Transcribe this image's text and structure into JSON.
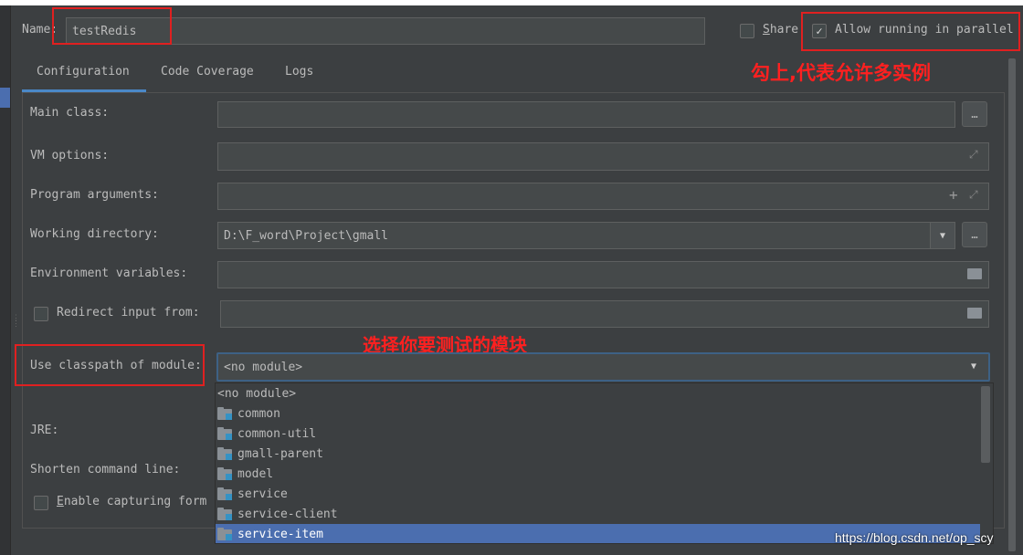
{
  "header": {
    "name_label": "Name:",
    "name_value": "testRedis",
    "share_label": "Share",
    "share_checked": false,
    "allow_parallel_label": "Allow running in parallel",
    "allow_parallel_checked": true
  },
  "annotations": {
    "parallel_note": "勾上,代表允许多实例",
    "module_note": "选择你要测试的模块"
  },
  "tabs": [
    {
      "label": "Configuration",
      "active": true
    },
    {
      "label": "Code Coverage",
      "active": false
    },
    {
      "label": "Logs",
      "active": false
    }
  ],
  "form": {
    "main_class_label": "Main class:",
    "main_class_value": "",
    "vm_options_label": "VM options:",
    "vm_options_value": "",
    "program_args_label": "Program arguments:",
    "program_args_value": "",
    "working_dir_label": "Working directory:",
    "working_dir_value": "D:\\F_word\\Project\\gmall",
    "env_vars_label": "Environment variables:",
    "env_vars_value": "",
    "redirect_label": "Redirect input from:",
    "redirect_checked": false,
    "classpath_label": "Use classpath of module:",
    "classpath_value": "<no module>",
    "jre_label": "JRE:",
    "shorten_label": "Shorten command line:",
    "capture_label": "Enable capturing form"
  },
  "module_list": [
    {
      "label": "<no module>",
      "icon": "none",
      "selected": false
    },
    {
      "label": "common",
      "icon": "module-folder-icon",
      "selected": false
    },
    {
      "label": "common-util",
      "icon": "module-folder-icon",
      "selected": false
    },
    {
      "label": "gmall-parent",
      "icon": "module-folder-icon",
      "selected": false
    },
    {
      "label": "model",
      "icon": "module-folder-icon",
      "selected": false
    },
    {
      "label": "service",
      "icon": "module-folder-icon",
      "selected": false
    },
    {
      "label": "service-client",
      "icon": "module-folder-icon",
      "selected": false
    },
    {
      "label": "service-item",
      "icon": "module-folder-icon",
      "selected": true
    }
  ],
  "footer": {
    "watermark": "https://blog.csdn.net/op_scy"
  },
  "colors": {
    "background": "#3c3f41",
    "input_bg": "#45494a",
    "accent": "#4a88c7",
    "selection": "#4b6eaf",
    "annotation": "#e02020"
  }
}
